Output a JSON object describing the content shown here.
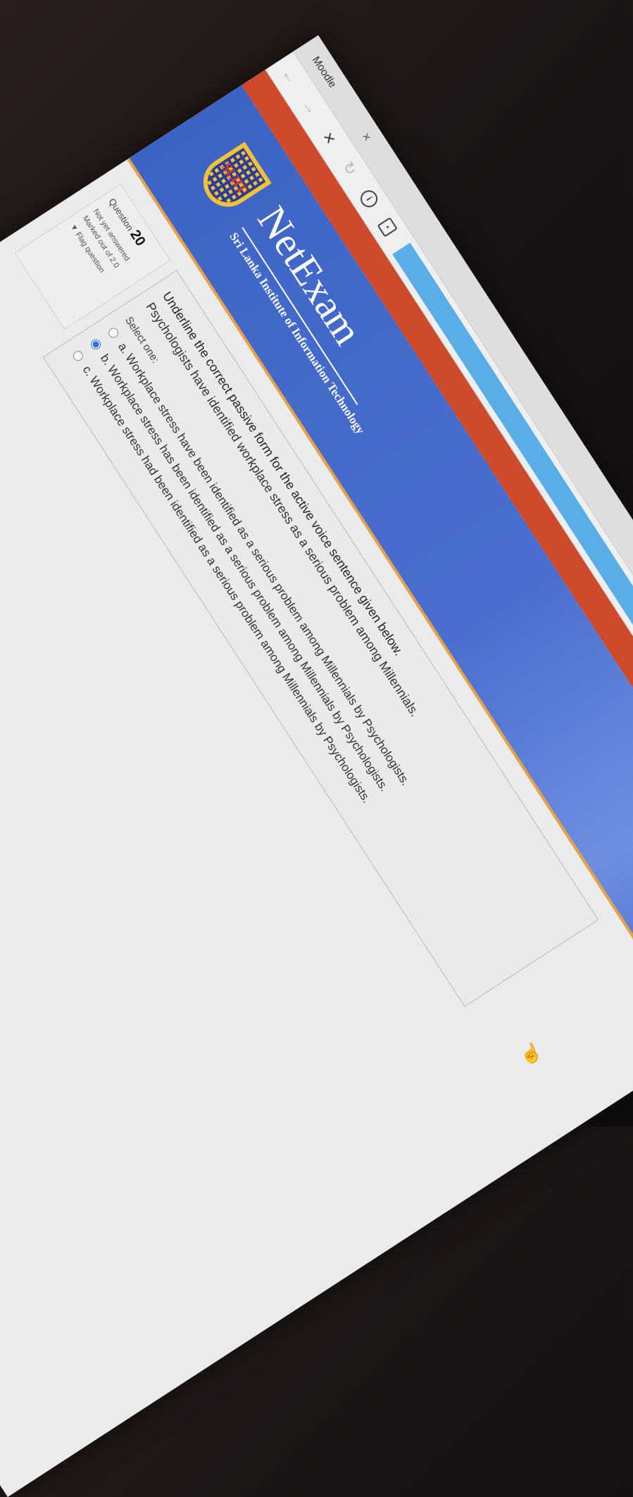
{
  "browser": {
    "tab_title": "Moodle",
    "tab_close": "×",
    "back": "←",
    "forward": "→",
    "stop": "×",
    "reload": "↻"
  },
  "header": {
    "logo_text": "SLIIT",
    "brand": "NetExam",
    "subtitle": "Sri Lanka Institute of Information Technology"
  },
  "question_info": {
    "label": "Question",
    "number": "20",
    "status": "Not yet answered",
    "marks": "Marked out of 2.0",
    "flag": "Flag question"
  },
  "question": {
    "text": "Underline the correct passive form for the active voice sentence given below.",
    "sentence": "Psychologists have identified workplace stress as a serious problem among Millennials.",
    "select_one": "Select one:",
    "options": [
      {
        "label": "a. Workplace stress have been identified as a serious problem among Millennials by Psychologists.",
        "checked": false
      },
      {
        "label": "b. Workplace stress has been identified as a serious problem among Millennials by Psychologists.",
        "checked": true
      },
      {
        "label": "c. Workplace stress had been identified as a serious problem among Millennials by Psychologists.",
        "checked": false
      }
    ]
  },
  "colors": {
    "banner": "#3d64c4",
    "topbar": "#cf4a2a",
    "urlbar": "#5aaee8",
    "accent": "#e8a040"
  }
}
